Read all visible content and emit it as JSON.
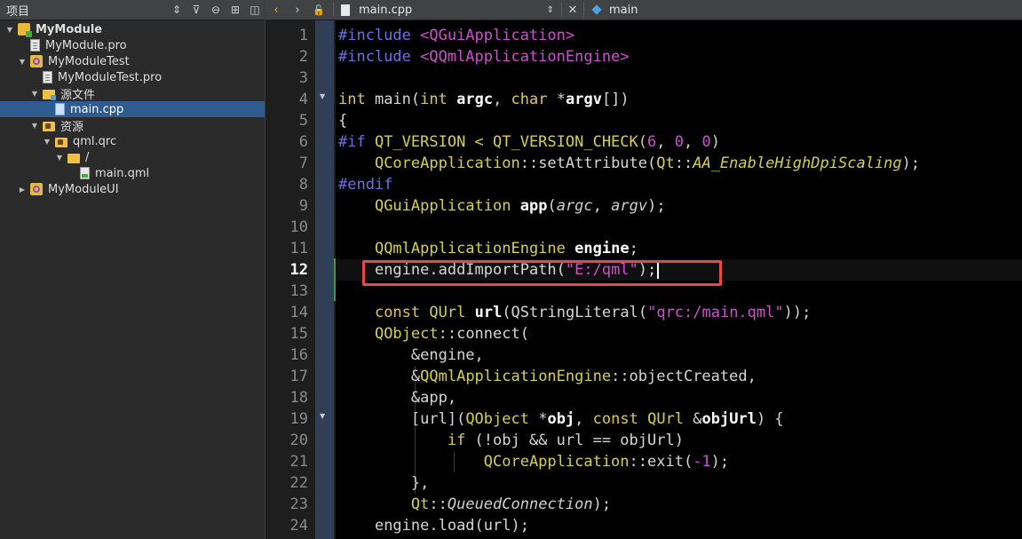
{
  "sidebar": {
    "title": "项目",
    "tools": {
      "updown": "⇕",
      "filter": "⊽",
      "link": "⊖",
      "split": "⊞",
      "collapse": "◫"
    },
    "tree": [
      {
        "label": "MyModule",
        "icon": "project-icon",
        "expanded": true,
        "bold": true
      },
      {
        "label": "MyModule.pro",
        "icon": "pro-file-icon"
      },
      {
        "label": "MyModuleTest",
        "icon": "subproject-icon",
        "expanded": true
      },
      {
        "label": "MyModuleTest.pro",
        "icon": "pro-file-icon"
      },
      {
        "label": "源文件",
        "icon": "sources-folder-icon",
        "expanded": true
      },
      {
        "label": "main.cpp",
        "icon": "cpp-file-icon",
        "selected": true
      },
      {
        "label": "资源",
        "icon": "resources-folder-icon",
        "expanded": true
      },
      {
        "label": "qml.qrc",
        "icon": "qrc-file-icon",
        "expanded": true
      },
      {
        "label": "/",
        "icon": "folder-icon",
        "expanded": true
      },
      {
        "label": "main.qml",
        "icon": "qml-file-icon"
      },
      {
        "label": "MyModuleUI",
        "icon": "subproject-icon",
        "expanded": false
      }
    ]
  },
  "editor": {
    "toolbar": {
      "back": "‹",
      "forward": "›",
      "lock": "🔓",
      "file_name": "main.cpp",
      "combo_arrows": "⇕",
      "close": "✕",
      "symbol": "main"
    },
    "current_line": 12,
    "line_numbers": [
      "1",
      "2",
      "3",
      "4",
      "5",
      "6",
      "7",
      "8",
      "9",
      "10",
      "11",
      "12",
      "13",
      "14",
      "15",
      "16",
      "17",
      "18",
      "19",
      "20",
      "21",
      "22",
      "23",
      "24"
    ],
    "fold_markers_at": [
      4,
      19
    ],
    "code": {
      "l1a": "#include ",
      "l1b": "<QGuiApplication>",
      "l2a": "#include ",
      "l2b": "<QQmlApplicationEngine>",
      "l4a": "int",
      "l4b": " main(",
      "l4c": "int",
      "l4d": " ",
      "l4e": "argc",
      "l4f": ", ",
      "l4g": "char",
      "l4h": " *",
      "l4i": "argv",
      "l4j": "[])",
      "l5": "{",
      "l6a": "#if",
      "l6b": " QT_VERSION < QT_VERSION_CHECK(",
      "l6c": "6",
      "l6d": ", ",
      "l6e": "0",
      "l6f": ", ",
      "l6g": "0",
      "l6h": ")",
      "l7a": "QCoreApplication",
      "l7b": "::setAttribute(",
      "l7c": "Qt",
      "l7d": "::",
      "l7e": "AA_EnableHighDpiScaling",
      "l7f": ");",
      "l8": "#endif",
      "l9a": "QGuiApplication",
      "l9b": " ",
      "l9c": "app",
      "l9d": "(",
      "l9e": "argc",
      "l9f": ", ",
      "l9g": "argv",
      "l9h": ");",
      "l11a": "QQmlApplicationEngine",
      "l11b": " ",
      "l11c": "engine",
      "l11d": ";",
      "l12a": "engine.addImportPath(",
      "l12b": "\"E:/qml\"",
      "l12c": ");",
      "l14a": "const",
      "l14b": " ",
      "l14c": "QUrl",
      "l14d": " ",
      "l14e": "url",
      "l14f": "(QStringLiteral(",
      "l14g": "\"qrc:/main.qml\"",
      "l14h": "));",
      "l15a": "QObject",
      "l15b": "::connect(",
      "l16": "&engine,",
      "l17a": "&",
      "l17b": "QQmlApplicationEngine",
      "l17c": "::objectCreated,",
      "l18": "&app,",
      "l19a": "[url](",
      "l19b": "QObject",
      "l19c": " *",
      "l19d": "obj",
      "l19e": ", ",
      "l19f": "const",
      "l19g": " ",
      "l19h": "QUrl",
      "l19i": " &",
      "l19j": "objUrl",
      "l19k": ") {",
      "l20a": "if",
      "l20b": " (!obj && url == objUrl)",
      "l21a": "QCoreApplication",
      "l21b": "::exit(",
      "l21c": "-1",
      "l21d": ");",
      "l22": "},",
      "l23a": "Qt",
      "l23b": "::",
      "l23c": "QueuedConnection",
      "l23d": ");",
      "l24": "engine.load(url);"
    }
  },
  "colors": {
    "selection": "#2e5c8e",
    "annotation_box": "#e5484d",
    "fold_strip": "#2f3f58",
    "code_background": "#000000"
  }
}
